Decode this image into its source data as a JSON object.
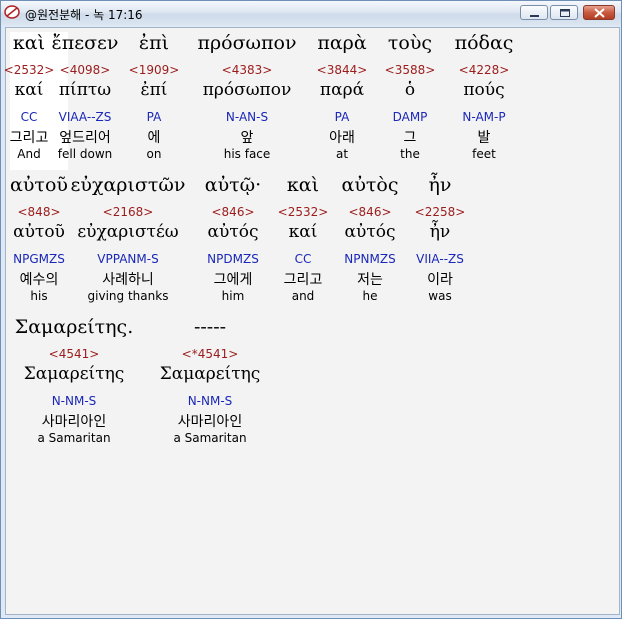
{
  "window": {
    "title": "@원전분해 - 녹 17:16"
  },
  "verse": {
    "rows": [
      {
        "tokens": [
          {
            "greek": "καὶ",
            "strong": "<2532>",
            "lemma": "καί",
            "parsing": "CC",
            "korean": "그리고",
            "english": "And"
          },
          {
            "greek": "ἔπεσεν",
            "strong": "<4098>",
            "lemma": "πίπτω",
            "parsing": "VIAA--ZS",
            "korean": "엎드리어",
            "english": "fell down"
          },
          {
            "greek": "ἐπὶ",
            "strong": "<1909>",
            "lemma": "ἐπί",
            "parsing": "PA",
            "korean": "에",
            "english": "on"
          },
          {
            "greek": "πρόσωπον",
            "strong": "<4383>",
            "lemma": "πρόσωπον",
            "parsing": "N-AN-S",
            "korean": "앞",
            "english": "his face"
          },
          {
            "greek": "παρὰ",
            "strong": "<3844>",
            "lemma": "παρά",
            "parsing": "PA",
            "korean": "아래",
            "english": "at"
          },
          {
            "greek": "τοὺς",
            "strong": "<3588>",
            "lemma": "ὁ",
            "parsing": "DAMP",
            "korean": "그",
            "english": "the"
          },
          {
            "greek": "πόδας",
            "strong": "<4228>",
            "lemma": "πούς",
            "parsing": "N-AM-P",
            "korean": "발",
            "english": "feet"
          }
        ]
      },
      {
        "tokens": [
          {
            "greek": "αὐτοῦ",
            "strong": "<848>",
            "lemma": "αὐτοῦ",
            "parsing": "NPGMZS",
            "korean": "예수의",
            "english": "his"
          },
          {
            "greek": "εὐχαριστῶν",
            "strong": "<2168>",
            "lemma": "εὐχαριστέω",
            "parsing": "VPPANM-S",
            "korean": "사례하니",
            "english": "giving thanks"
          },
          {
            "greek": "αὐτῷ·",
            "strong": "<846>",
            "lemma": "αὐτός",
            "parsing": "NPDMZS",
            "korean": "그에게",
            "english": "him"
          },
          {
            "greek": "καὶ",
            "strong": "<2532>",
            "lemma": "καί",
            "parsing": "CC",
            "korean": "그리고",
            "english": "and"
          },
          {
            "greek": "αὐτὸς",
            "strong": "<846>",
            "lemma": "αὐτός",
            "parsing": "NPNMZS",
            "korean": "저는",
            "english": "he"
          },
          {
            "greek": "ἦν",
            "strong": "<2258>",
            "lemma": "ἦν",
            "parsing": "VIIA--ZS",
            "korean": "이라",
            "english": "was"
          }
        ]
      },
      {
        "tokens": [
          {
            "greek": "Σαμαρείτης.",
            "strong": "<4541>",
            "lemma": "Σαμαρείτης",
            "parsing": "N-NM-S",
            "korean": "사마리아인",
            "english": "a Samaritan"
          },
          {
            "greek": "-----",
            "strong": "<*4541>",
            "lemma": "Σαμαρείτης",
            "parsing": "N-NM-S",
            "korean": "사마리아인",
            "english": "a Samaritan"
          }
        ]
      }
    ]
  },
  "colors": {
    "strong": "#9b1c1c",
    "parsing": "#1a27b8"
  }
}
